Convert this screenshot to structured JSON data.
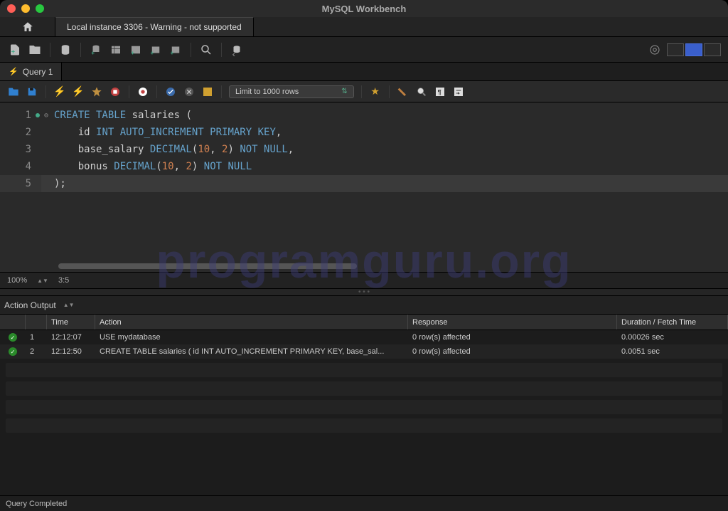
{
  "title": "MySQL Workbench",
  "connection_tab": "Local instance 3306 - Warning - not supported",
  "query_tab": "Query 1",
  "limit": "Limit to 1000 rows",
  "zoom": "100%",
  "cursor": "3:5",
  "output_header": "Action Output",
  "columns": {
    "time": "Time",
    "action": "Action",
    "response": "Response",
    "duration": "Duration / Fetch Time"
  },
  "rows": [
    {
      "idx": "1",
      "time": "12:12:07",
      "action": "USE mydatabase",
      "response": "0 row(s) affected",
      "duration": "0.00026 sec"
    },
    {
      "idx": "2",
      "time": "12:12:50",
      "action": "CREATE TABLE salaries (     id INT AUTO_INCREMENT PRIMARY KEY,     base_sal...",
      "response": "0 row(s) affected",
      "duration": "0.0051 sec"
    }
  ],
  "code": {
    "l1": {
      "a": "CREATE TABLE",
      "b": " salaries ",
      "c": "("
    },
    "l2": {
      "a": "    id ",
      "b": "INT AUTO_INCREMENT PRIMARY KEY",
      "c": ","
    },
    "l3": {
      "a": "    base_salary ",
      "b": "DECIMAL",
      "c": "(",
      "d": "10",
      "e": ", ",
      "f": "2",
      "g": ") ",
      "h": "NOT NULL",
      "i": ","
    },
    "l4": {
      "a": "    bonus ",
      "b": "DECIMAL",
      "c": "(",
      "d": "10",
      "e": ", ",
      "f": "2",
      "g": ") ",
      "h": "NOT NULL"
    },
    "l5": {
      "a": ");"
    }
  },
  "footer": "Query Completed",
  "watermark": "programguru.org"
}
